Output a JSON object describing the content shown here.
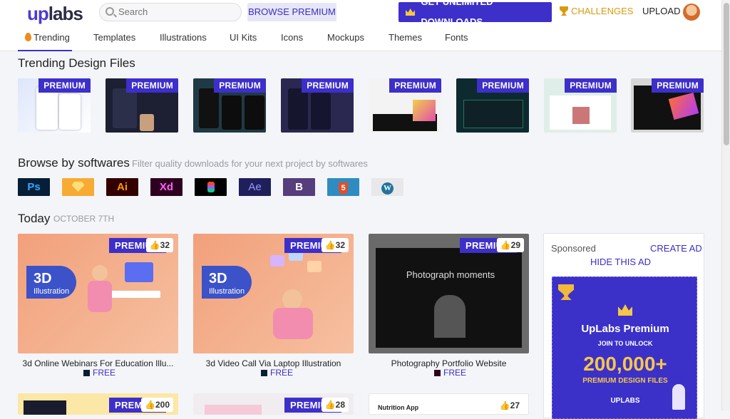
{
  "header": {
    "logo_up": "up",
    "logo_labs": "labs",
    "search_placeholder": "Search",
    "browse_premium": "BROWSE PREMIUM",
    "get_unlimited": "GET UNLIMITED DOWNLOADS",
    "challenges": "CHALLENGES",
    "upload": "UPLOAD"
  },
  "nav": {
    "tabs": [
      {
        "label": "Trending"
      },
      {
        "label": "Templates"
      },
      {
        "label": "Illustrations"
      },
      {
        "label": "UI Kits"
      },
      {
        "label": "Icons"
      },
      {
        "label": "Mockups"
      },
      {
        "label": "Themes"
      },
      {
        "label": "Fonts"
      }
    ]
  },
  "trending": {
    "title": "Trending Design Files",
    "badge": "PREMIUM"
  },
  "softwares": {
    "title": "Browse by softwares",
    "subtitle": "Filter quality downloads for your next project by softwares",
    "items": [
      {
        "label": "Ps",
        "name": "photoshop"
      },
      {
        "label": "",
        "name": "sketch"
      },
      {
        "label": "Ai",
        "name": "illustrator"
      },
      {
        "label": "Xd",
        "name": "xd"
      },
      {
        "label": "",
        "name": "figma"
      },
      {
        "label": "Ae",
        "name": "after-effects"
      },
      {
        "label": "B",
        "name": "bootstrap"
      },
      {
        "label": "5",
        "name": "html5"
      },
      {
        "label": "W",
        "name": "wordpress"
      }
    ]
  },
  "today": {
    "title": "Today",
    "date": "OCTOBER 7TH",
    "cards": [
      {
        "badge": "PREMIUM",
        "likes": "32",
        "title": "3d Online Webinars For Education Illu...",
        "price": "FREE"
      },
      {
        "badge": "PREMIUM",
        "likes": "32",
        "title": "3d Video Call Via Laptop Illustration",
        "price": "FREE"
      },
      {
        "badge": "PREMIUM",
        "likes": "29",
        "title": "Photography Portfolio Website",
        "price": "FREE"
      }
    ],
    "bottom_cards": [
      {
        "badge": "PREMIUM",
        "likes": "200"
      },
      {
        "badge": "PREMIUM",
        "likes": "28"
      },
      {
        "badge": "",
        "likes": "27",
        "caption": "Nutrition App"
      }
    ]
  },
  "sponsor": {
    "label": "Sponsored",
    "create_ad": "CREATE AD",
    "hide_ad": "HIDE THIS AD",
    "ad_title": "UpLabs Premium",
    "ad_join": "JOIN TO UNLOCK",
    "ad_count": "200,000+",
    "ad_files": "PREMIUM DESIGN FILES",
    "ad_brand": "UPLABS"
  },
  "card_art": {
    "big_3d": "3D",
    "illustration": "Illustration",
    "photograph": "Photograph moments"
  }
}
